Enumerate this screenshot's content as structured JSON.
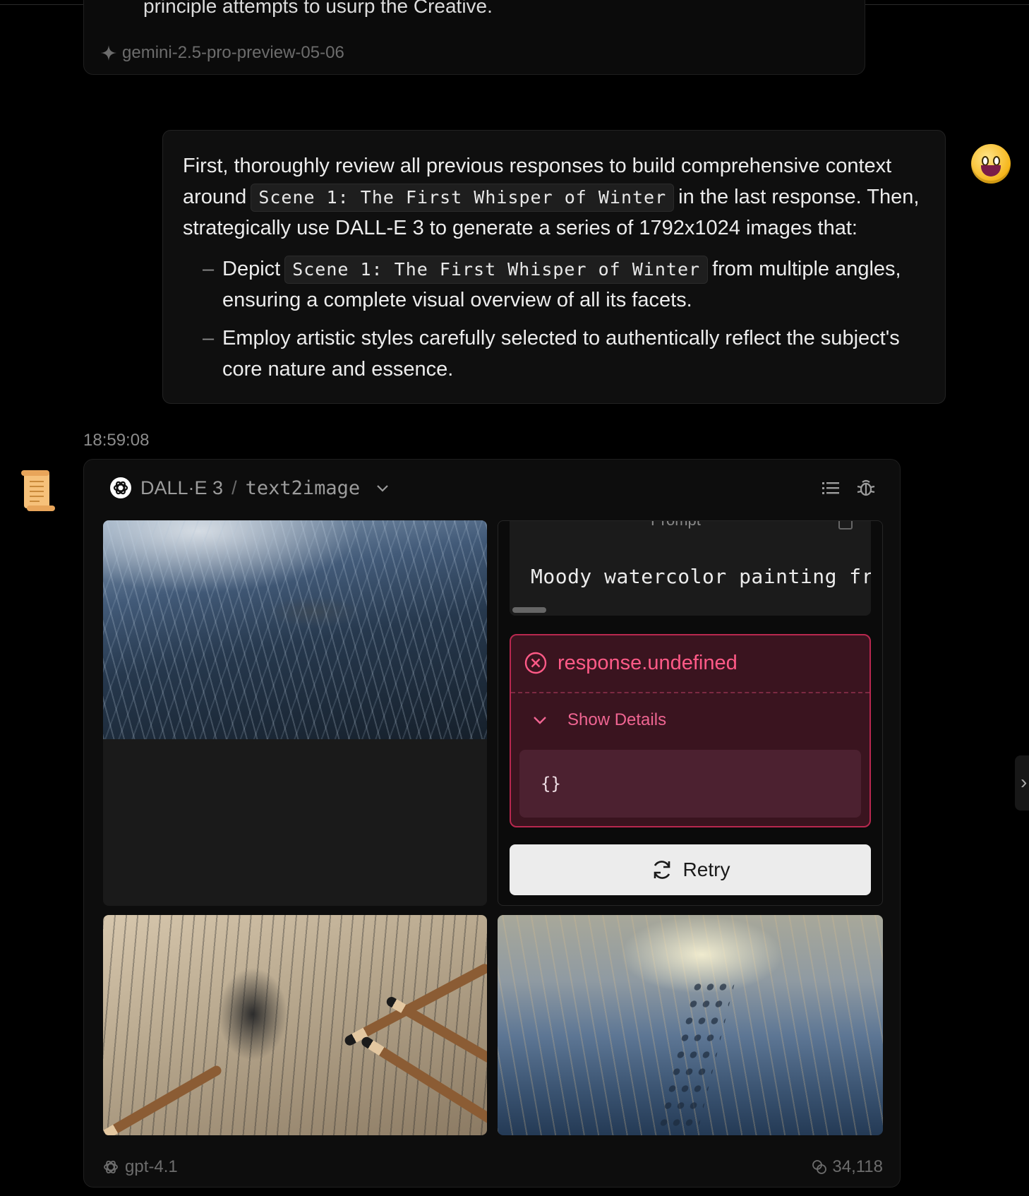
{
  "previous_message": {
    "truncated_text": "principle attempts to usurp the Creative.",
    "model_label": "gemini-2.5-pro-preview-05-06"
  },
  "user_message": {
    "intro_pre": "First, thoroughly review all previous responses to build comprehensive context around",
    "scene_ref": "Scene 1: The First Whisper of Winter",
    "intro_post": "in the last response. Then, strategically use DALL-E 3 to generate a series of 1792x1024 images that:",
    "bullets": {
      "b1_pre": "Depict",
      "b1_scene": "Scene 1: The First Whisper of Winter",
      "b1_post": "from multiple angles, ensuring a complete visual overview of all its facets.",
      "b2": "Employ artistic styles carefully selected to authentically reflect the subject's core nature and essence."
    }
  },
  "timestamp": "18:59:08",
  "assistant": {
    "tool_name": "DALL·E 3",
    "tool_sep": "/",
    "tool_action": "text2image",
    "icons": [
      "openai-icon",
      "chevron-down-icon",
      "list-icon",
      "bug-icon"
    ],
    "prompt_panel": {
      "title": "Prompt",
      "text": "Moody watercolor painting fro"
    },
    "error": {
      "message": "response.undefined",
      "toggle_label": "Show Details",
      "details": "{}"
    },
    "retry_label": "Retry",
    "footer": {
      "model": "gpt-4.1",
      "tokens": "34,118"
    }
  },
  "colors": {
    "background": "#000000",
    "error_text": "#ff5a87",
    "error_border": "#b8284f",
    "error_bg": "#3a141f",
    "retry_bg": "#ececec"
  }
}
